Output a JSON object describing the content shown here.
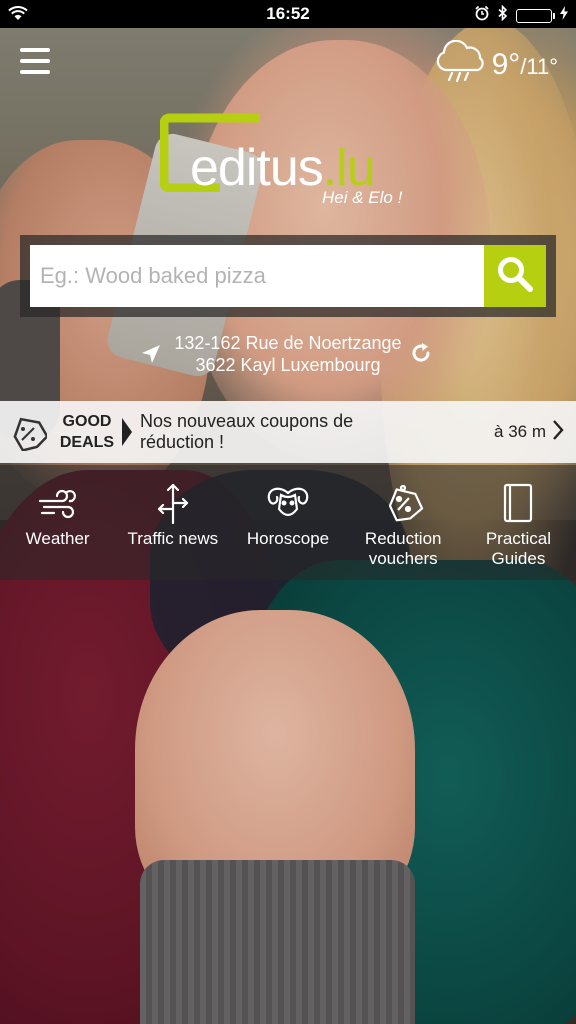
{
  "status_bar": {
    "time": "16:52"
  },
  "weather_widget": {
    "temp_current": "9°",
    "temp_high": "/11°",
    "icon": "rain-cloud-icon"
  },
  "logo": {
    "brand_prefix": "editus",
    "brand_suffix": ".lu",
    "tagline": "Hei & Elo !"
  },
  "search": {
    "placeholder": "Eg.: Wood baked pizza"
  },
  "location": {
    "line1": "132-162 Rue de Noertzange",
    "line2": "3622 Kayl Luxembourg"
  },
  "deals": {
    "label_line1": "GOOD",
    "label_line2": "DEALS",
    "text_line1": "Nos nouveaux coupons de",
    "text_line2": "réduction !",
    "distance": "à 36 m"
  },
  "shortcuts": [
    {
      "label": "Weather",
      "icon": "wind-icon"
    },
    {
      "label": "Traffic news",
      "icon": "directions-icon"
    },
    {
      "label": "Horoscope",
      "icon": "ram-icon"
    },
    {
      "label_line1": "Reduction",
      "label_line2": "vouchers",
      "icon": "coupon-tag-icon"
    },
    {
      "label_line1": "Practical",
      "label_line2": "Guides",
      "icon": "book-icon"
    }
  ],
  "colors": {
    "accent": "#b6cf10",
    "status_bg": "#000000",
    "battery": "#4cd964"
  }
}
